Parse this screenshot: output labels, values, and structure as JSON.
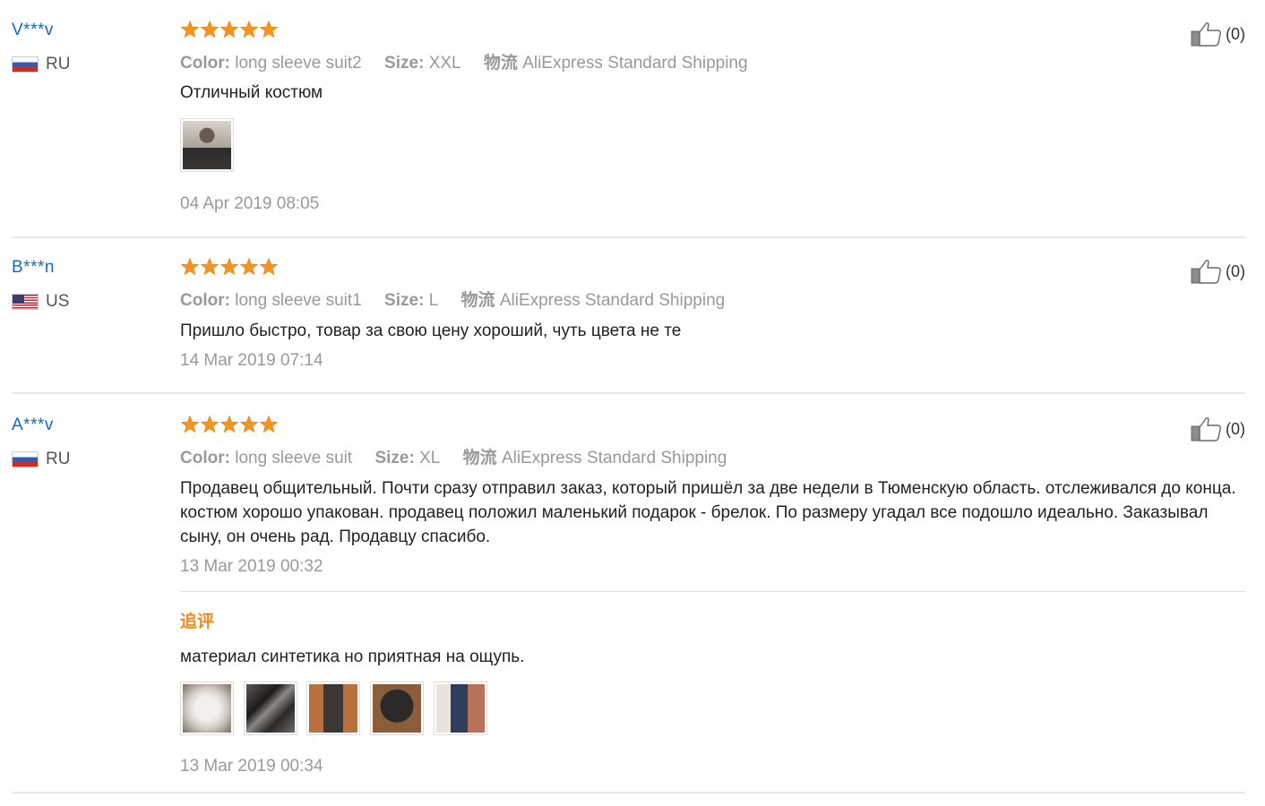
{
  "reviews": [
    {
      "username": "V***v",
      "country": "RU",
      "color_label": "Color:",
      "color_value": "long sleeve suit2",
      "size_label": "Size:",
      "size_value": "XXL",
      "shipping_label": "物流",
      "shipping_value": "AliExpress Standard Shipping",
      "text": "Отличный костюм",
      "date": "04 Apr 2019 08:05",
      "likes": "(0)",
      "rating": 5
    },
    {
      "username": "B***n",
      "country": "US",
      "color_label": "Color:",
      "color_value": "long sleeve suit1",
      "size_label": "Size:",
      "size_value": "L",
      "shipping_label": "物流",
      "shipping_value": "AliExpress Standard Shipping",
      "text": "Пришло быстро, товар за свою цену хороший, чуть цвета не те",
      "date": "14 Mar 2019 07:14",
      "likes": "(0)",
      "rating": 5
    },
    {
      "username": "A***v",
      "country": "RU",
      "color_label": "Color:",
      "color_value": "long sleeve suit",
      "size_label": "Size:",
      "size_value": "XL",
      "shipping_label": "物流",
      "shipping_value": "AliExpress Standard Shipping",
      "text": "Продавец общительный. Почти сразу отправил заказ, который пришёл за две недели в Тюменскую область. отслеживался до конца. костюм хорошо упакован. продавец положил маленький подарок - брелок. По размеру угадал все подошло идеально. Заказывал сыну, он очень рад. Продавцу спасибо.",
      "date": "13 Mar 2019 00:32",
      "likes": "(0)",
      "rating": 5,
      "followup": {
        "label": "追评",
        "text": "материал синтетика но приятная на ощупь.",
        "date": "13 Mar 2019 00:34"
      }
    }
  ],
  "icons": {
    "star": "star-icon",
    "like": "thumbs-up-icon"
  },
  "colors": {
    "username": "#1268c8",
    "star": "#f5941e",
    "followup": "#ef8a1d",
    "muted": "#999999"
  }
}
